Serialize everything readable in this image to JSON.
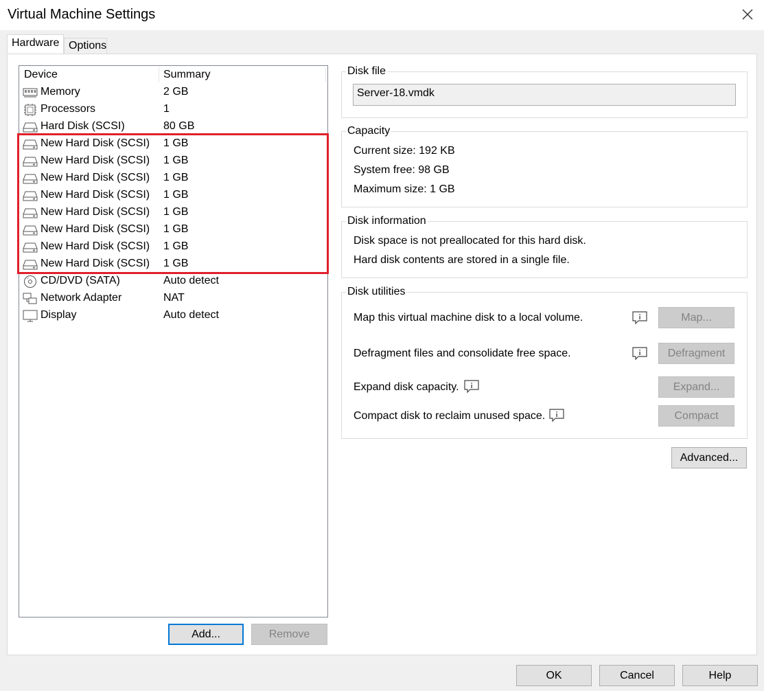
{
  "window": {
    "title": "Virtual Machine Settings"
  },
  "tabs": [
    {
      "label": "Hardware",
      "active": true
    },
    {
      "label": "Options",
      "active": false
    }
  ],
  "device_list": {
    "columns": [
      "Device",
      "Summary"
    ],
    "rows": [
      {
        "name": "Memory",
        "summary": "2 GB",
        "icon": "memory-icon"
      },
      {
        "name": "Processors",
        "summary": "1",
        "icon": "processor-icon"
      },
      {
        "name": "Hard Disk (SCSI)",
        "summary": "80 GB",
        "icon": "hard-disk-icon"
      },
      {
        "name": "New Hard Disk (SCSI)",
        "summary": "1 GB",
        "icon": "hard-disk-icon"
      },
      {
        "name": "New Hard Disk (SCSI)",
        "summary": "1 GB",
        "icon": "hard-disk-icon"
      },
      {
        "name": "New Hard Disk (SCSI)",
        "summary": "1 GB",
        "icon": "hard-disk-icon"
      },
      {
        "name": "New Hard Disk (SCSI)",
        "summary": "1 GB",
        "icon": "hard-disk-icon"
      },
      {
        "name": "New Hard Disk (SCSI)",
        "summary": "1 GB",
        "icon": "hard-disk-icon"
      },
      {
        "name": "New Hard Disk (SCSI)",
        "summary": "1 GB",
        "icon": "hard-disk-icon"
      },
      {
        "name": "New Hard Disk (SCSI)",
        "summary": "1 GB",
        "icon": "hard-disk-icon"
      },
      {
        "name": "New Hard Disk (SCSI)",
        "summary": "1 GB",
        "icon": "hard-disk-icon"
      },
      {
        "name": "CD/DVD (SATA)",
        "summary": "Auto detect",
        "icon": "cd-dvd-icon"
      },
      {
        "name": "Network Adapter",
        "summary": "NAT",
        "icon": "network-adapter-icon"
      },
      {
        "name": "Display",
        "summary": "Auto detect",
        "icon": "display-icon"
      }
    ],
    "add_label": "Add...",
    "remove_label": "Remove"
  },
  "disk_file": {
    "title": "Disk file",
    "value": "Server-18.vmdk"
  },
  "capacity": {
    "title": "Capacity",
    "current_size": "Current size:  192 KB",
    "system_free": "System free:  98 GB",
    "maximum_size": "Maximum size:  1 GB"
  },
  "disk_information": {
    "title": "Disk information",
    "line1": "Disk space is not preallocated for this hard disk.",
    "line2": "Hard disk contents are stored in a single file."
  },
  "disk_utilities": {
    "title": "Disk utilities",
    "map_text": "Map this virtual machine disk to a local volume.",
    "map_button": "Map...",
    "defrag_text": "Defragment files and consolidate free space.",
    "defrag_button": "Defragment",
    "expand_text": "Expand disk capacity.",
    "expand_button": "Expand...",
    "compact_text": "Compact disk to reclaim unused space.",
    "compact_button": "Compact"
  },
  "advanced_button": "Advanced...",
  "footer": {
    "ok": "OK",
    "cancel": "Cancel",
    "help": "Help"
  },
  "colors": {
    "highlight": "#e0202a",
    "focus": "#0078d7"
  }
}
